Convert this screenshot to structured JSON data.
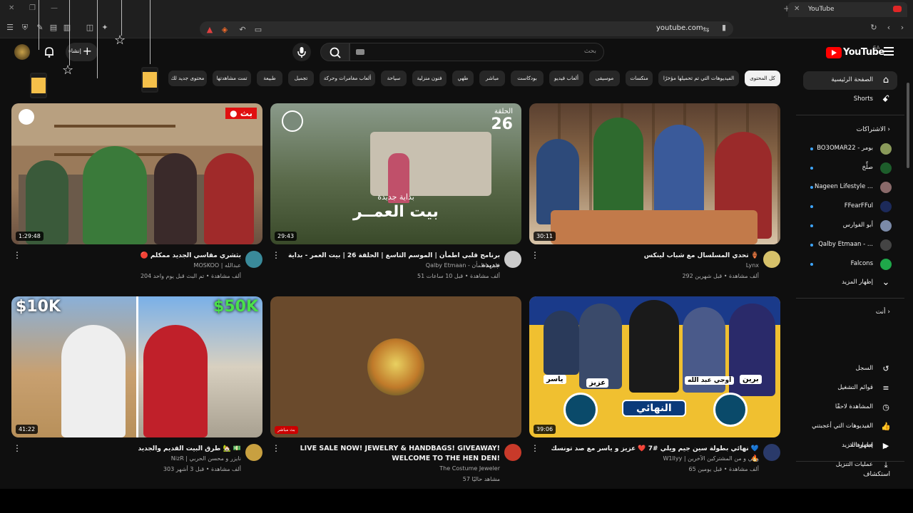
{
  "browser": {
    "tab_title": "YouTube",
    "url": "youtube.com"
  },
  "header": {
    "logo_text": "YouTube",
    "region": "SA",
    "search_placeholder": "بحث",
    "create_label": "إنشاء"
  },
  "chips": [
    "كل المحتوى",
    "الفيديوهات التي تم تحميلها مؤخرًا",
    "منكسات",
    "موسيقى",
    "ألعاب فيديو",
    "بودكاست",
    "مباشر",
    "طهي",
    "فنون منزلية",
    "سياحة",
    "ألعاب مغامرات وحركة",
    "تجميل",
    "طبيعة",
    "تمت مشاهدتها",
    "محتوى جديد لك"
  ],
  "sidebar": {
    "main": [
      {
        "label": "الصفحة الرئيسية",
        "icon": "home-icon",
        "active": true
      },
      {
        "label": "Shorts",
        "icon": "shorts-icon",
        "active": false
      }
    ],
    "subscriptions_heading": "الاشتراكات",
    "subscriptions": [
      {
        "label": "BO3OMAR22 - بومر",
        "color": "#8a9a5a"
      },
      {
        "label": "صلِّخ",
        "color": "#1d5d2b"
      },
      {
        "label": "Nageen Lifestyle ...",
        "color": "#8a6a6a"
      },
      {
        "label": "FFearFFul",
        "color": "#1c2a5a"
      },
      {
        "label": "أبو الفوارس",
        "color": "#7b8aa8"
      },
      {
        "label": "Qalby Etmaan - ...",
        "color": "#444444"
      },
      {
        "label": "Falcons",
        "color": "#1fa84a"
      }
    ],
    "show_more_1": "إظهار المزيد",
    "you_heading": "أنت",
    "you": [
      {
        "label": "السجل",
        "icon": "history-icon"
      },
      {
        "label": "قوائم التشغيل",
        "icon": "playlists-icon"
      },
      {
        "label": "المشاهدة لاحقًا",
        "icon": "watch-later-icon"
      },
      {
        "label": "الفيديوهات التي أعجبتني",
        "icon": "like-icon"
      },
      {
        "label": "فيديوهاتك",
        "icon": "your-videos-icon"
      },
      {
        "label": "عمليات التنزيل",
        "icon": "download-icon"
      }
    ],
    "show_more_2": "إظهار المزيد",
    "explore_heading": "استكشاف"
  },
  "videos": [
    {
      "title": "تحدي المسلسال مع شباب لينكس 🏺",
      "channel": "Lynx",
      "meta": "292 ألف مشاهدة • قبل شهرين",
      "duration": "30:11",
      "avatar_color": "#d6c16a"
    },
    {
      "title": "برنامج قلبي اطمأن | الموسم التاسع | الحلقة 26 | بيت العمر - بداية جديدة",
      "channel": "Qalby Etmaan - قلبي اطمأن",
      "meta": "51 ألف مشاهدة • قبل 10 ساعات",
      "duration": "29:43",
      "avatar_color": "#cccccc"
    },
    {
      "title": "🔴 بثشري مقاسي الجديد ممكلم",
      "channel": "MOSKOO | عبدالله",
      "meta": "204 ألف مشاهدة • تم البث قبل يوم واحد",
      "duration": "1:29:48",
      "avatar_color": "#3a8a9a"
    },
    {
      "title": "نهائي بطولة سين جيم ويلي #7 ❤️ عزيز و ياسر مع صد تونسك 💙 🔥",
      "channel": "W1llyy | ويلي و من المشتركين الآخرين",
      "meta": "65 ألف مشاهدة • قبل يومين",
      "duration": "39:06",
      "avatar_color": "#2a3a6a"
    },
    {
      "title": "LIVE SALE NOW! JEWELRY & HANDBAGS! GIVEAWAY! WELCOME TO THE HEN DEN!",
      "channel": "The Costume Jeweler",
      "meta": "57 مشاهد حاليًا",
      "duration": "بث مباشر",
      "avatar_color": "#c83a2a"
    },
    {
      "title": "طرق البيت القديم والجديد 🏡 💵",
      "channel": "NizR | نايزر و محسن الحربي",
      "meta": "303 ألف مشاهدة • قبل 3 أشهر",
      "duration": "41:22",
      "avatar_color": "#c8a040"
    }
  ],
  "thumb_text": {
    "v1_badge_ep": "الحلقة",
    "v1_badge_num": "26",
    "v1_caption_small": "بداية جديدة",
    "v1_caption_big": "بيت العمــر",
    "v0_live": "بث",
    "v5_left": "$10K",
    "v5_right": "$50K",
    "v3_names": [
      "برين",
      "أوجي عبد الله",
      "عزيز",
      "ياسر"
    ],
    "v3_final": "النهائي"
  }
}
